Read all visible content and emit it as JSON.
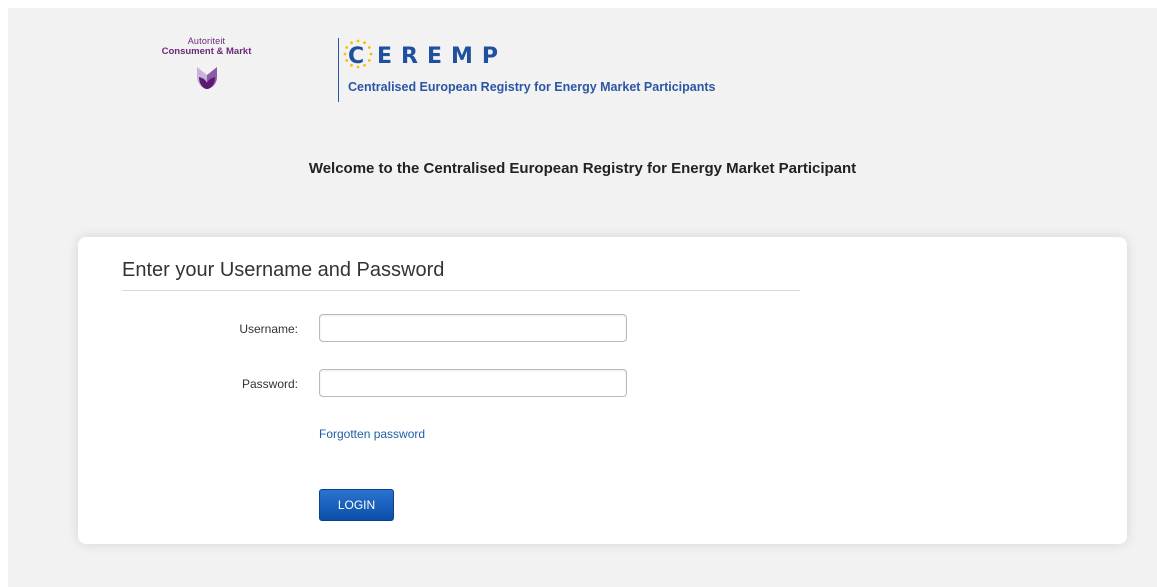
{
  "header": {
    "acm_logo": {
      "line1": "Autoriteit",
      "line2": "Consument & Markt"
    },
    "ceremp_logo": {
      "letters": [
        "C",
        "E",
        "R",
        "E",
        "M",
        "P"
      ],
      "subtitle": "Centralised European Registry for Energy Market Participants",
      "color": "#1f4f9e",
      "stars_color": "#f2c200"
    }
  },
  "welcome_text": "Welcome to the Centralised European Registry for Energy Market Participant",
  "login_form": {
    "heading": "Enter your Username and Password",
    "username_label": "Username:",
    "username_value": "",
    "password_label": "Password:",
    "password_value": "",
    "forgot_password_link": "Forgotten password",
    "login_button": "LOGIN"
  },
  "colors": {
    "page_background": "#f2f2f2",
    "button_blue": "#0b4fa8",
    "link_blue": "#1f5fa8"
  }
}
